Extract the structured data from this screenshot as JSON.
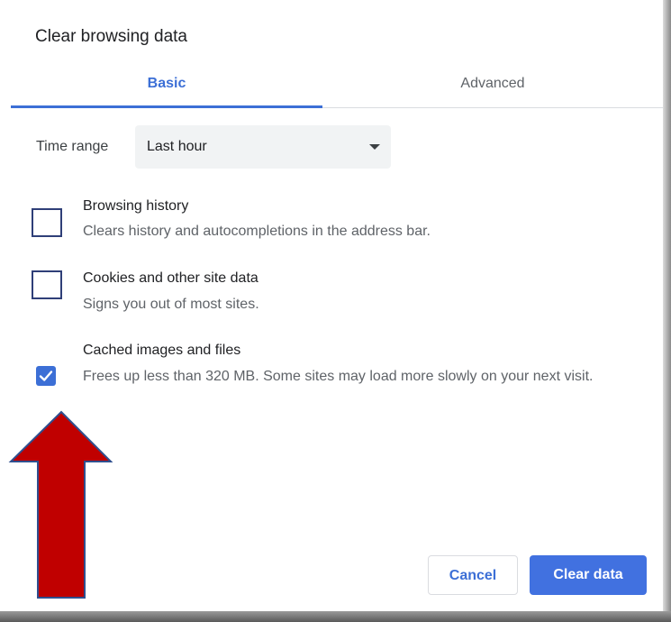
{
  "dialog": {
    "title": "Clear browsing data",
    "tabs": [
      {
        "label": "Basic",
        "active": true
      },
      {
        "label": "Advanced",
        "active": false
      }
    ],
    "time_range": {
      "label": "Time range",
      "value": "Last hour"
    },
    "items": [
      {
        "title": "Browsing history",
        "description": "Clears history and autocompletions in the address bar.",
        "checked": false
      },
      {
        "title": "Cookies and other site data",
        "description": "Signs you out of most sites.",
        "checked": false
      },
      {
        "title": "Cached images and files",
        "description": "Frees up less than 320 MB. Some sites may load more slowly on your next visit.",
        "checked": true
      }
    ],
    "buttons": {
      "cancel": "Cancel",
      "clear": "Clear data"
    }
  },
  "colors": {
    "accent": "#3c6fd6",
    "primary_button": "#4171e0",
    "annotation_arrow": "#c00000",
    "annotation_arrow_border": "#2f4f8f"
  }
}
